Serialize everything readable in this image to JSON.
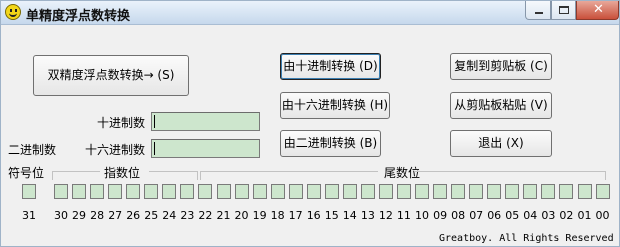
{
  "window": {
    "title": "单精度浮点数转换",
    "icon": "smiley-face-icon"
  },
  "buttons": {
    "double_convert": "双精度浮点数转换→ (S)",
    "from_decimal": "由十进制转换 (D)",
    "from_hex": "由十六进制转换 (H)",
    "from_binary": "由二进制转换 (B)",
    "copy_clipboard": "复制到剪贴板 (C)",
    "paste_clipboard": "从剪贴板粘贴 (V)",
    "exit": "退出 (X)"
  },
  "fields": {
    "decimal_label": "十进制数",
    "decimal_value": "",
    "hex_label": "十六进制数",
    "hex_value": "",
    "binary_label": "二进制数"
  },
  "bit_groups": {
    "sign": "符号位",
    "exponent": "指数位",
    "mantissa": "尾数位"
  },
  "bit_numbers": [
    "31",
    "30",
    "29",
    "28",
    "27",
    "26",
    "25",
    "24",
    "23",
    "22",
    "21",
    "20",
    "19",
    "18",
    "17",
    "16",
    "15",
    "14",
    "13",
    "12",
    "11",
    "10",
    "09",
    "08",
    "07",
    "06",
    "05",
    "04",
    "03",
    "02",
    "01",
    "00"
  ],
  "footer": "Greatboy. All Rights Reserved",
  "colors": {
    "field_bg": "#cde6cd",
    "window_bg": "#f0f0f0"
  }
}
